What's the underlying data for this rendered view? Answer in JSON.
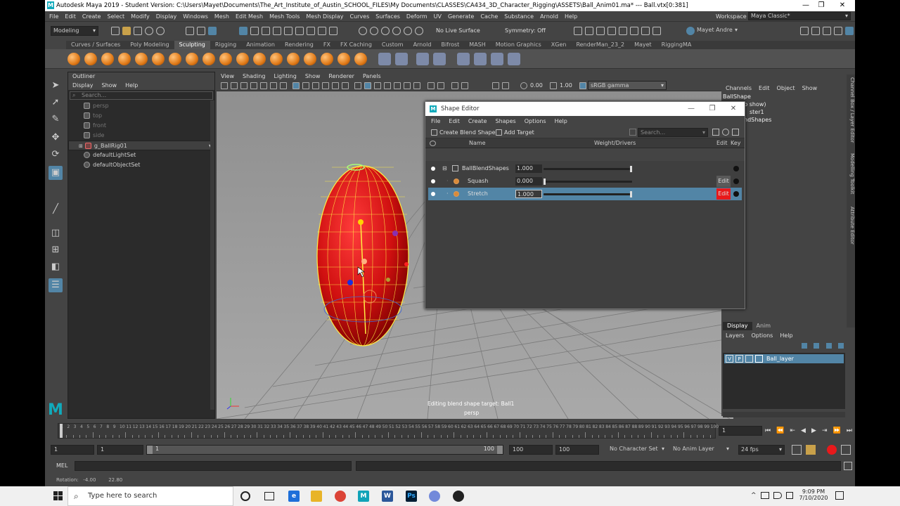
{
  "window": {
    "title": "Autodesk Maya 2019 - Student Version: C:\\Users\\Mayet\\Documents\\The_Art_Institute_of_Austin_SCHOOL_FILES\\My Documents\\CLASSES\\CA434_3D_Character_Rigging\\ASSETS\\Ball_Anim01.ma*  ---  Ball.vtx[0:381]",
    "logo": "M",
    "minimize": "—",
    "maximize": "❐",
    "close": "✕"
  },
  "menubar": [
    "File",
    "Edit",
    "Create",
    "Select",
    "Modify",
    "Display",
    "Windows",
    "Mesh",
    "Edit Mesh",
    "Mesh Tools",
    "Mesh Display",
    "Curves",
    "Surfaces",
    "Deform",
    "UV",
    "Generate",
    "Cache",
    "Substance",
    "Arnold",
    "Help"
  ],
  "workspace": {
    "label": "Workspace :",
    "value": "Maya Classic*"
  },
  "status": {
    "mode": "Modeling",
    "live_surface": "No Live Surface",
    "symmetry": "Symmetry: Off",
    "user": "Mayet Andre"
  },
  "shelf_tabs": [
    "Curves / Surfaces",
    "Poly Modeling",
    "Sculpting",
    "Rigging",
    "Animation",
    "Rendering",
    "FX",
    "FX Caching",
    "Custom",
    "Arnold",
    "Bifrost",
    "MASH",
    "Motion Graphics",
    "XGen",
    "RenderMan_23_2",
    "Mayet",
    "RiggingMA"
  ],
  "shelf_active": "Sculpting",
  "outliner": {
    "title": "Outliner",
    "menu": [
      "Display",
      "Show",
      "Help"
    ],
    "search": "Search...",
    "items": [
      {
        "label": "persp",
        "dim": true
      },
      {
        "label": "top",
        "dim": true
      },
      {
        "label": "front",
        "dim": true
      },
      {
        "label": "side",
        "dim": true
      },
      {
        "label": "g_BallRig01",
        "dim": false
      },
      {
        "label": "defaultLightSet",
        "dim": false
      },
      {
        "label": "defaultObjectSet",
        "dim": false
      }
    ]
  },
  "viewport": {
    "menu": [
      "View",
      "Shading",
      "Lighting",
      "Show",
      "Renderer",
      "Panels"
    ],
    "exposure": "0.00",
    "gamma": "1.00",
    "colorspace": "sRGB gamma",
    "hud_message": "Editing blend shape target: Ball1",
    "camera": "persp"
  },
  "shape_editor": {
    "title": "Shape Editor",
    "logo": "M",
    "menu": [
      "File",
      "Edit",
      "Create",
      "Shapes",
      "Options",
      "Help"
    ],
    "create_blend_shape": "Create Blend Shape",
    "add_target": "Add Target",
    "search": "Search...",
    "col_name": "Name",
    "col_weight": "Weight/Drivers",
    "col_edit": "Edit",
    "col_key": "Key",
    "rows": [
      {
        "name": "BallBlendShapes",
        "value": "1.000",
        "weight": 1.0,
        "edit": "",
        "selected": false
      },
      {
        "name": "Squash",
        "value": "0.000",
        "weight": 0.0,
        "edit": "Edit",
        "selected": false
      },
      {
        "name": "Stretch",
        "value": "1.000",
        "weight": 1.0,
        "edit": "Edit",
        "selected": true
      }
    ],
    "colors": {
      "edit_active": "#e8191b",
      "selection": "#5285a6"
    }
  },
  "channel_box": {
    "menu": [
      "Channels",
      "Edit",
      "Object",
      "Show"
    ],
    "lines": [
      "BallShape",
      "k to show)",
      "ster1",
      "ndShapes"
    ]
  },
  "layers": {
    "tabs": [
      "Display",
      "Anim"
    ],
    "menu": [
      "Layers",
      "Options",
      "Help"
    ],
    "layer": {
      "v": "V",
      "p": "P",
      "name": "Ball_layer"
    }
  },
  "side_tabs": [
    "Channel Box / Layer Editor",
    "Modelling Toolkit",
    "Attribute Editor"
  ],
  "timeline": {
    "ticks": [
      "1",
      "2",
      "3",
      "4",
      "5",
      "6",
      "7",
      "8",
      "9",
      "10",
      "11",
      "12",
      "13",
      "14",
      "15",
      "16",
      "17",
      "18",
      "19",
      "20",
      "21",
      "22",
      "23",
      "24",
      "25",
      "26",
      "27",
      "28",
      "29",
      "30",
      "31",
      "32",
      "33",
      "34",
      "35",
      "36",
      "37",
      "38",
      "39",
      "40",
      "41",
      "42",
      "43",
      "44",
      "45",
      "46",
      "47",
      "48",
      "49",
      "50",
      "51",
      "52",
      "53",
      "54",
      "55",
      "56",
      "57",
      "58",
      "59",
      "60",
      "61",
      "62",
      "63",
      "64",
      "65",
      "66",
      "67",
      "68",
      "69",
      "70",
      "71",
      "72",
      "73",
      "74",
      "75",
      "76",
      "77",
      "78",
      "79",
      "80",
      "81",
      "82",
      "83",
      "84",
      "85",
      "86",
      "87",
      "88",
      "89",
      "90",
      "91",
      "92",
      "93",
      "94",
      "95",
      "96",
      "97",
      "98",
      "99",
      "100"
    ],
    "current": "1"
  },
  "range": {
    "start": "1",
    "start2": "1",
    "slider_start": "1",
    "slider_end": "100",
    "end": "100",
    "end2": "100",
    "character_set": "No Character Set",
    "anim_layer": "No Anim Layer",
    "fps": "24 fps"
  },
  "mel": {
    "label": "MEL"
  },
  "helpline": {
    "text": "Rotation:   -4.00        22.80"
  },
  "taskbar": {
    "search": "Type here to search",
    "time": "9:09 PM",
    "date": "7/10/2020"
  }
}
